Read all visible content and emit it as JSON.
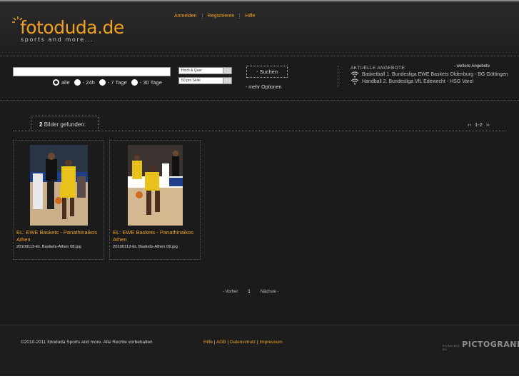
{
  "header": {
    "logo_text": "fotoduda.de",
    "tagline": "sports and more...",
    "nav": [
      {
        "label": "Anmelden"
      },
      {
        "label": "Registrieren"
      },
      {
        "label": "Hilfe"
      }
    ]
  },
  "search": {
    "query_value": "",
    "filters": [
      {
        "label": "alle",
        "checked": true
      },
      {
        "label": "- 24h",
        "checked": false
      },
      {
        "label": "- 7 Tage",
        "checked": false
      },
      {
        "label": "- 30 Tage",
        "checked": false
      }
    ],
    "format_select": "Hoch & Quer",
    "perpage_select": "50 pro Seite",
    "button_label": "- Suchen",
    "more_options": "- mehr Optionen"
  },
  "offers": {
    "title": "AKTUELLE ANGEBOTE:",
    "more_link": "- weitere Angebote",
    "items": [
      {
        "text": "Basketball 1. Bundesliga EWE Baskets Oldenburg - BG Göttingen"
      },
      {
        "text": "Handball 2. Bundesliga VfL Edewecht - HSG Varel"
      }
    ]
  },
  "results": {
    "count": "2",
    "count_label": "Bilder gefunden:",
    "pager_top": {
      "prev": "‹‹",
      "range": "1-2",
      "next": "››"
    },
    "cards": [
      {
        "title": "EL: EWE Baskets - Panathinaikos Athen",
        "filename": "20100113-EL Baskets-Athen 08.jpg"
      },
      {
        "title": "EL: EWE Baskets - Panathinaikos Athen",
        "filename": "20100113-EL Baskets-Athen 09.jpg"
      }
    ],
    "pager_bottom": {
      "prev": "- Vorher",
      "page": "1",
      "next": "Nächste -"
    }
  },
  "footer": {
    "copyright": "©2010-2011 fotoduda Sports and more. Alle Rechte vorbehalten",
    "links": [
      {
        "label": "Hilfe"
      },
      {
        "label": "AGB"
      },
      {
        "label": "Datenschutz"
      },
      {
        "label": "Impressum"
      }
    ],
    "powered_by": "POWERED BY",
    "brand": "PICTOGRANDE"
  },
  "colors": {
    "accent": "#f0a023",
    "background": "#1b1b1b"
  }
}
